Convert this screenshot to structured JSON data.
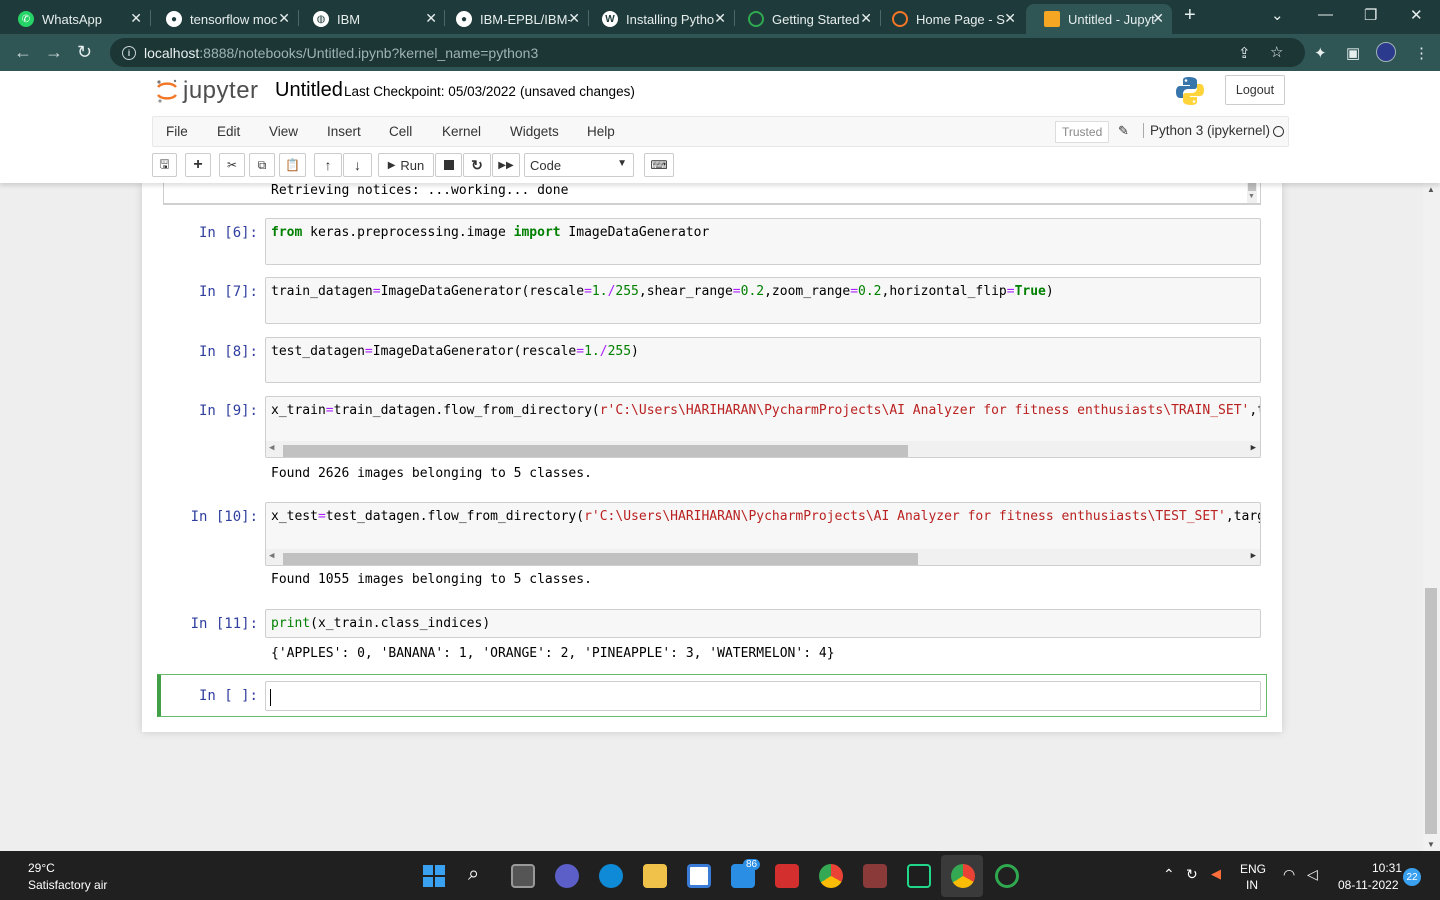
{
  "browser": {
    "tabs": [
      {
        "label": "WhatsApp",
        "icon": "whatsapp-icon",
        "color": "#25d366"
      },
      {
        "label": "tensorflow moc",
        "icon": "github-icon",
        "color": "#ffffff"
      },
      {
        "label": "IBM",
        "icon": "globe-icon",
        "color": "#ffffff"
      },
      {
        "label": "IBM-EPBL/IBM-",
        "icon": "github-icon",
        "color": "#ffffff"
      },
      {
        "label": "Installing Pytho",
        "icon": "wordpress-icon",
        "color": "#ffffff"
      },
      {
        "label": "Getting Started",
        "icon": "loading-icon",
        "color": "#2fa84f"
      },
      {
        "label": "Home Page - S",
        "icon": "jupyter-icon",
        "color": "#f37626"
      },
      {
        "label": "Untitled - Jupyt",
        "icon": "notebook-icon",
        "color": "#f5a623"
      }
    ],
    "url_host": "localhost",
    "url_rest": ":8888/notebooks/Untitled.ipynb?kernel_name=python3"
  },
  "jupyter": {
    "logo_text": "jupyter",
    "notebook_title": "Untitled",
    "checkpoint": "Last Checkpoint: 05/03/2022",
    "unsaved": "(unsaved changes)",
    "logout": "Logout",
    "menus": [
      "File",
      "Edit",
      "View",
      "Insert",
      "Cell",
      "Kernel",
      "Widgets",
      "Help"
    ],
    "trusted": "Trusted",
    "kernel": "Python 3 (ipykernel)",
    "toolbar": {
      "run_label": "Run",
      "cell_type": "Code"
    }
  },
  "notebook": {
    "top_output": "Retrieving notices: ...working... done",
    "cells": [
      {
        "prompt": "In [6]:"
      },
      {
        "prompt": "In [7]:"
      },
      {
        "prompt": "In [8]:"
      },
      {
        "prompt": "In [9]:",
        "output": "Found 2626 images belonging to 5 classes."
      },
      {
        "prompt": "In [10]:",
        "output": "Found 1055 images belonging to 5 classes."
      },
      {
        "prompt": "In [11]:",
        "output": "{'APPLES': 0, 'BANANA': 1, 'ORANGE': 2, 'PINEAPPLE': 3, 'WATERMELON': 4}"
      },
      {
        "prompt": "In [ ]:"
      }
    ]
  },
  "taskbar": {
    "weather_temp": "29°C",
    "weather_desc": "Satisfactory air",
    "mail_badge": "86",
    "lang_1": "ENG",
    "lang_2": "IN",
    "time": "10:31",
    "date": "08-11-2022",
    "notif_count": "22"
  }
}
